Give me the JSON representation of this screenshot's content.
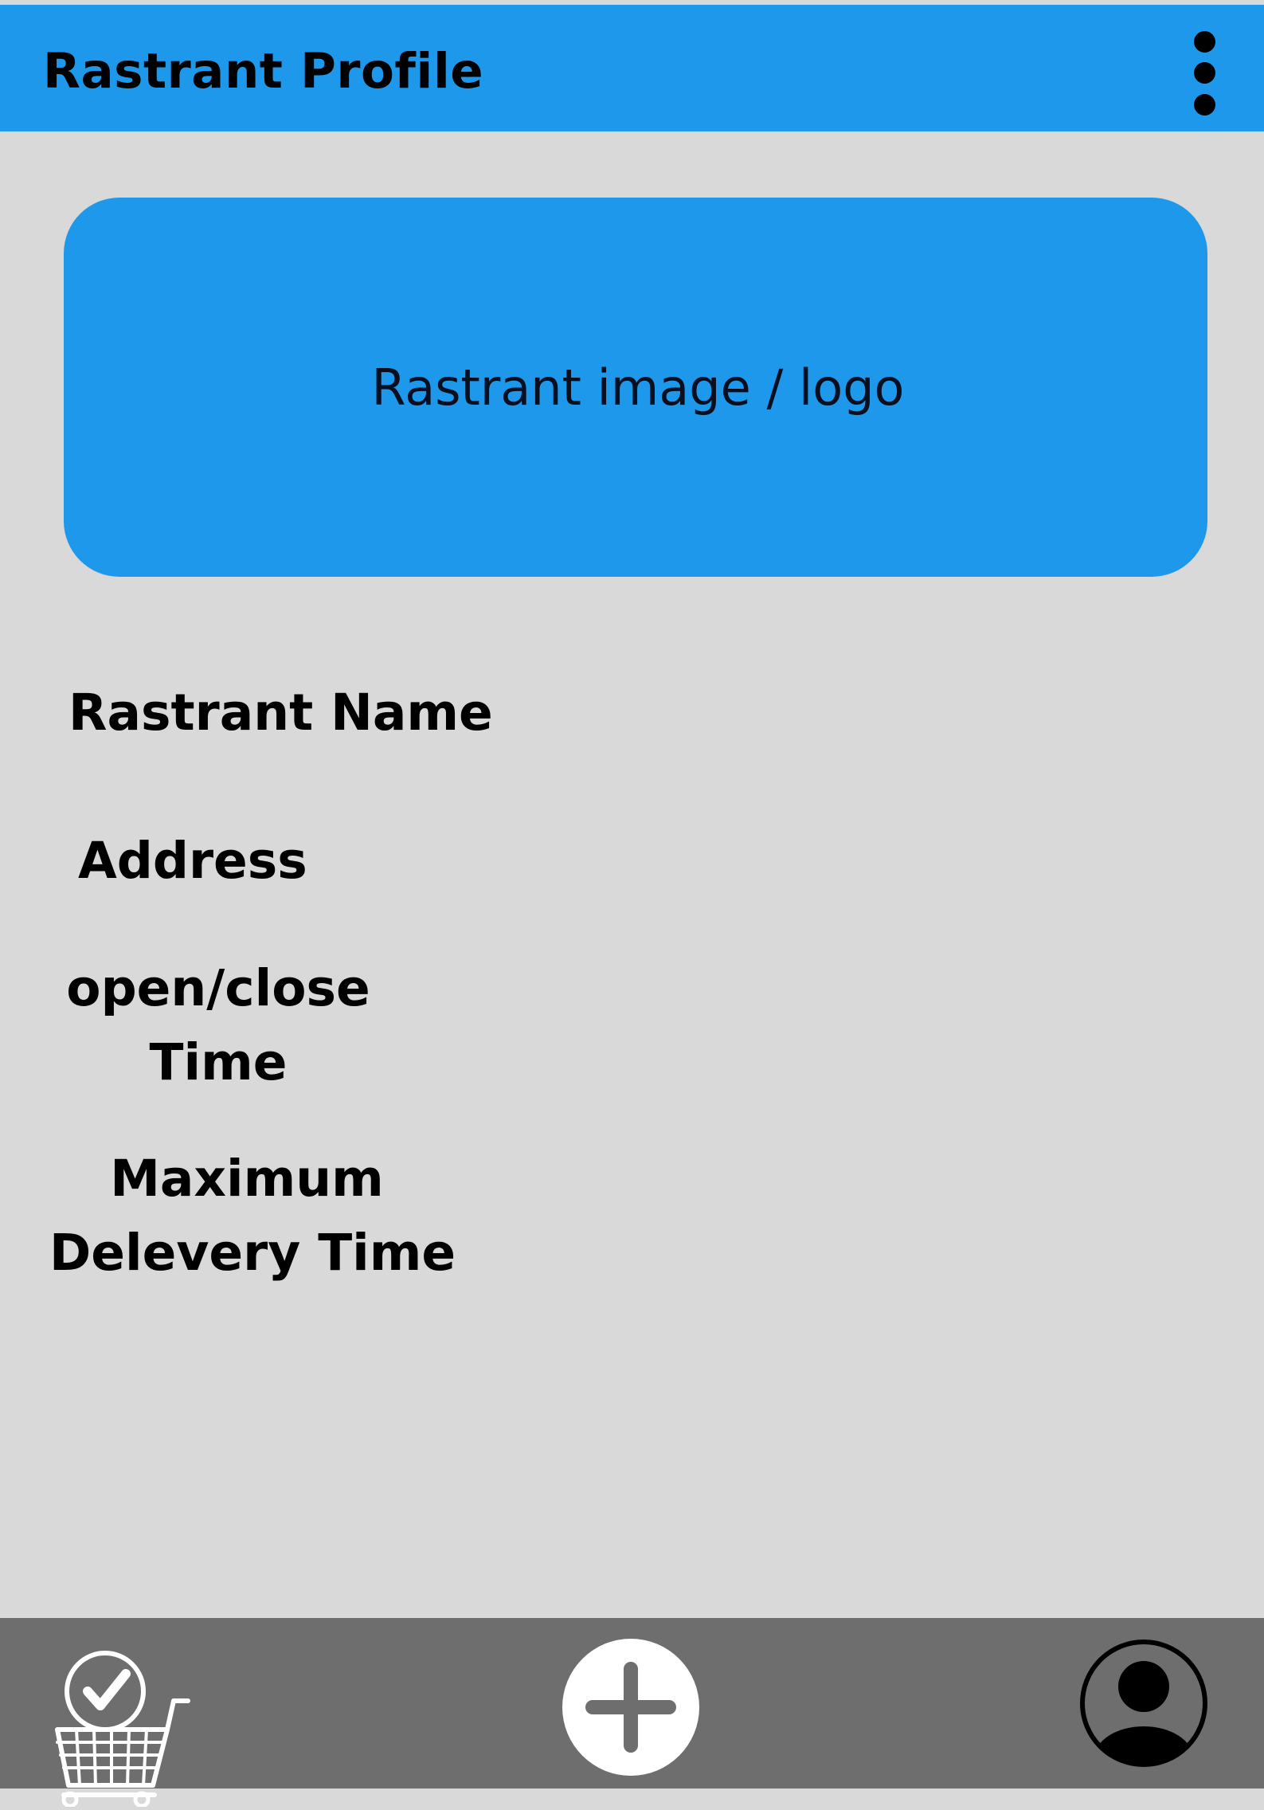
{
  "app_bar": {
    "title": "Rastrant Profile",
    "menu_icon": "more-vertical-icon"
  },
  "hero": {
    "label": "Rastrant image / logo"
  },
  "fields": {
    "name_label": "Rastrant Name",
    "address_label": "Address",
    "hours_label_line1": "open/close",
    "hours_label_line2": "Time",
    "delivery_label_line1": "Maximum",
    "delivery_label_line2": "Delevery Time"
  },
  "bottom_nav": {
    "items": [
      {
        "icon": "shopping-cart-check-icon"
      },
      {
        "icon": "add-circle-icon"
      },
      {
        "icon": "user-profile-icon"
      }
    ]
  },
  "colors": {
    "accent_blue": "#1e98eb",
    "background": "#d9d9d9",
    "nav_gray": "#6e6e6e"
  }
}
